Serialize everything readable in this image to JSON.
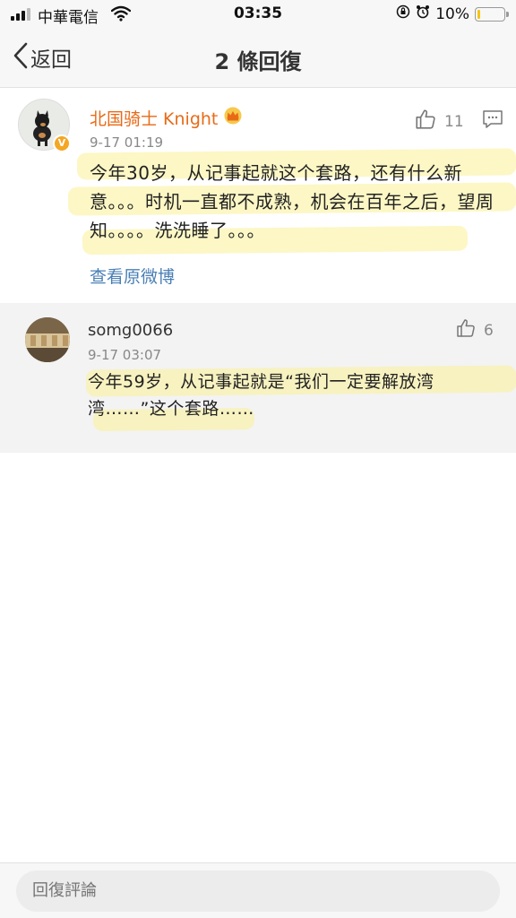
{
  "status_bar": {
    "carrier": "中華電信",
    "time": "03:35",
    "battery_percent": "10%",
    "battery_level": 0.1,
    "icons": [
      "signal-icon",
      "wifi-icon",
      "orientation-lock-icon",
      "alarm-icon",
      "battery-icon"
    ]
  },
  "nav": {
    "back_label": "返回",
    "title": "2 條回復"
  },
  "main_comment": {
    "username": "北国骑士 Knight",
    "badge_icon": "crown-badge-icon",
    "verified_mark": "V",
    "time": "9-17 01:19",
    "likes": "11",
    "text": "今年30岁，从记事起就这个套路，还有什么新意。。。时机一直都不成熟，机会在百年之后，望周知。。。。洗洗睡了。。。",
    "view_original": "查看原微博"
  },
  "reply": {
    "username": "somg0066",
    "time": "9-17 03:07",
    "likes": "6",
    "text": "今年59岁，从记事起就是“我们一定要解放湾湾……”这个套路……"
  },
  "bottom": {
    "input_placeholder": "回復評論"
  },
  "colors": {
    "username_accent": "#e86a17",
    "link": "#4a7fb5",
    "verified": "#f5a623",
    "highlight": "#faf096"
  }
}
